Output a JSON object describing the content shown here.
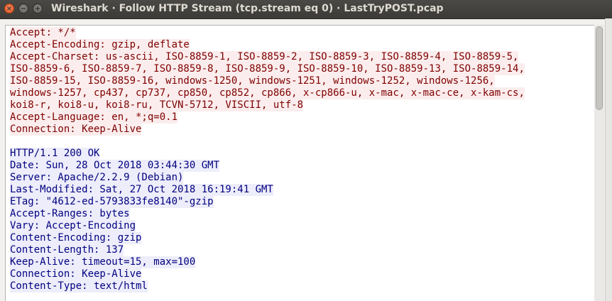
{
  "window": {
    "title": "Wireshark · Follow HTTP Stream (tcp.stream eq 0) · LastTryPOST.pcap",
    "close_glyph": "×",
    "minimize_glyph": "−",
    "maximize_glyph": "+"
  },
  "colors": {
    "client_fg": "#7f0000",
    "client_bg": "#fbeded",
    "server_fg": "#00007f",
    "server_bg": "#ededfb"
  },
  "stream": {
    "client_lines": [
      "Accept: */*",
      "Accept-Encoding: gzip, deflate",
      "Accept-Charset: us-ascii, ISO-8859-1, ISO-8859-2, ISO-8859-3, ISO-8859-4, ISO-8859-5,",
      "ISO-8859-6, ISO-8859-7, ISO-8859-8, ISO-8859-9, ISO-8859-10, ISO-8859-13, ISO-8859-14,",
      "ISO-8859-15, ISO-8859-16, windows-1250, windows-1251, windows-1252, windows-1256,",
      "windows-1257, cp437, cp737, cp850, cp852, cp866, x-cp866-u, x-mac, x-mac-ce, x-kam-cs,",
      "koi8-r, koi8-u, koi8-ru, TCVN-5712, VISCII, utf-8",
      "Accept-Language: en, *;q=0.1",
      "Connection: Keep-Alive"
    ],
    "server_lines": [
      "HTTP/1.1 200 OK",
      "Date: Sun, 28 Oct 2018 03:44:30 GMT",
      "Server: Apache/2.2.9 (Debian)",
      "Last-Modified: Sat, 27 Oct 2018 16:19:41 GMT",
      "ETag: \"4612-ed-5793833fe8140\"-gzip",
      "Accept-Ranges: bytes",
      "Vary: Accept-Encoding",
      "Content-Encoding: gzip",
      "Content-Length: 137",
      "Keep-Alive: timeout=15, max=100",
      "Connection: Keep-Alive",
      "Content-Type: text/html"
    ]
  }
}
